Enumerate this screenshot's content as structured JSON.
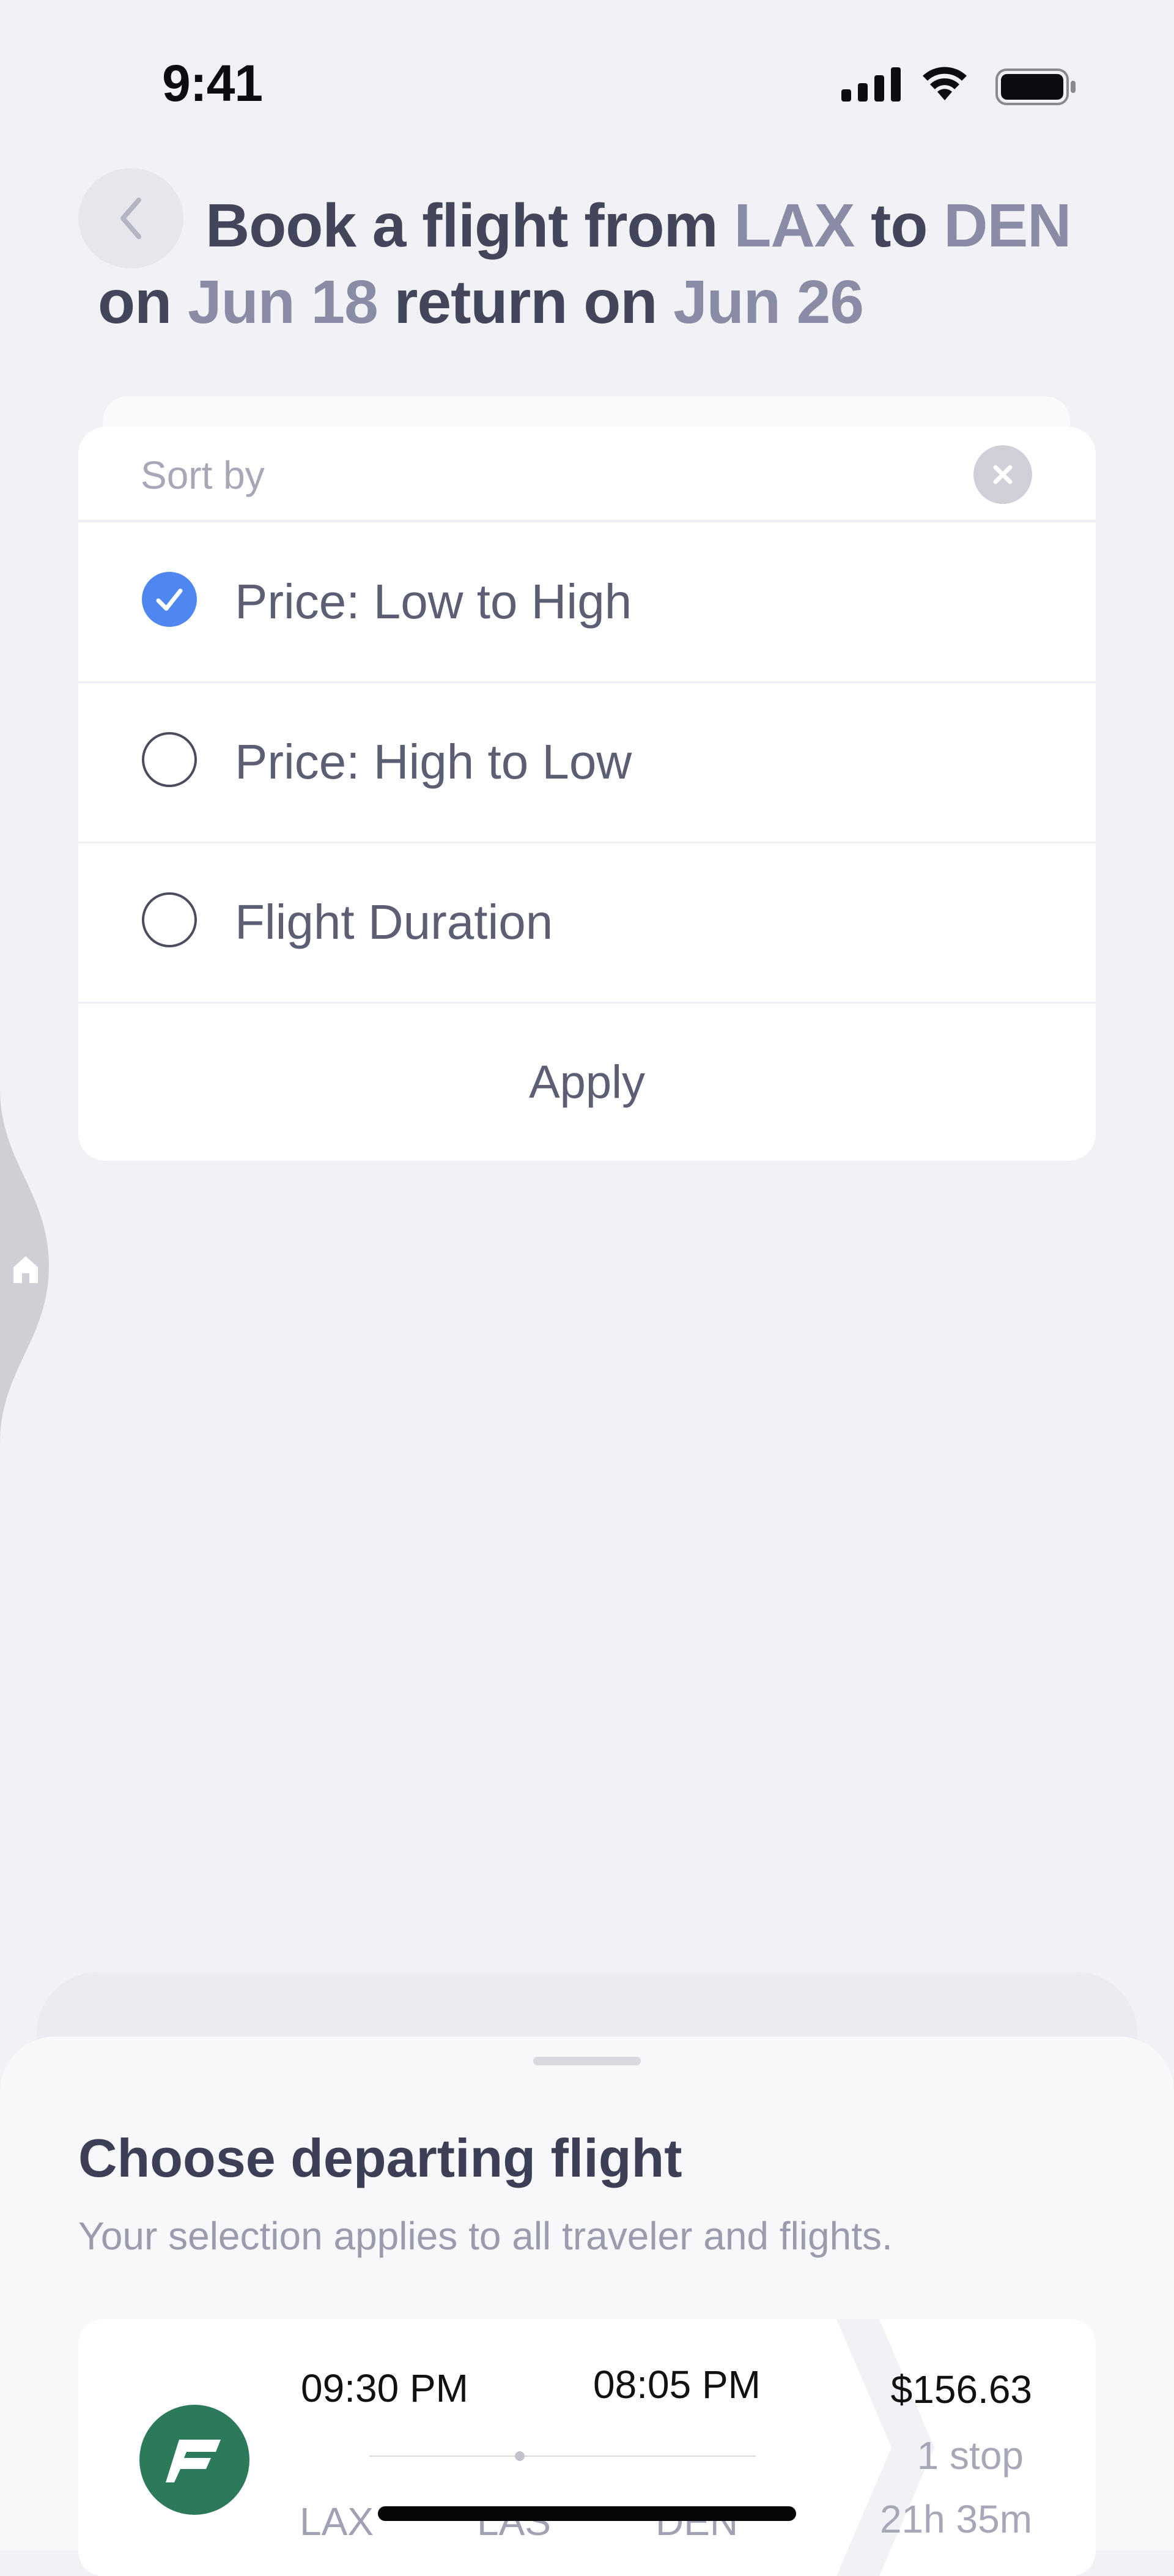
{
  "status_bar": {
    "time": "9:41",
    "icons": [
      "cellular-signal-icon",
      "wifi-icon",
      "battery-icon"
    ]
  },
  "header": {
    "back_icon": "chevron-left-icon",
    "line1": {
      "prefix": "Book a flight from ",
      "origin": "LAX",
      "mid": " to ",
      "destination": "DEN"
    },
    "line2": {
      "prefix": "on ",
      "depart_date": "Jun 18",
      "mid": " return on ",
      "return_date": "Jun 26"
    }
  },
  "sort_panel": {
    "title": "Sort by",
    "close_icon": "close-icon",
    "options": [
      {
        "label": "Price: Low to High",
        "selected": true
      },
      {
        "label": "Price: High to Low",
        "selected": false
      },
      {
        "label": "Flight Duration",
        "selected": false
      }
    ],
    "apply_label": "Apply"
  },
  "edge_handle": {
    "icon": "home-icon"
  },
  "sheet": {
    "title": "Choose departing flight",
    "subtitle": "Your selection applies to all traveler and flights.",
    "flights": [
      {
        "airline_logo": "airline-logo-icon",
        "depart_time": "09:30 PM",
        "arrive_time": "08:05 PM",
        "origin": "LAX",
        "stopover": "LAS",
        "destination": "DEN",
        "price": "$156.63",
        "stops": "1 stop",
        "duration": "21h 35m"
      }
    ]
  },
  "colors": {
    "accent": "#4f86f0",
    "highlight_text": "#8a8ca6",
    "background": "#f1f1f6",
    "airline_brand": "#2c7a5a"
  }
}
